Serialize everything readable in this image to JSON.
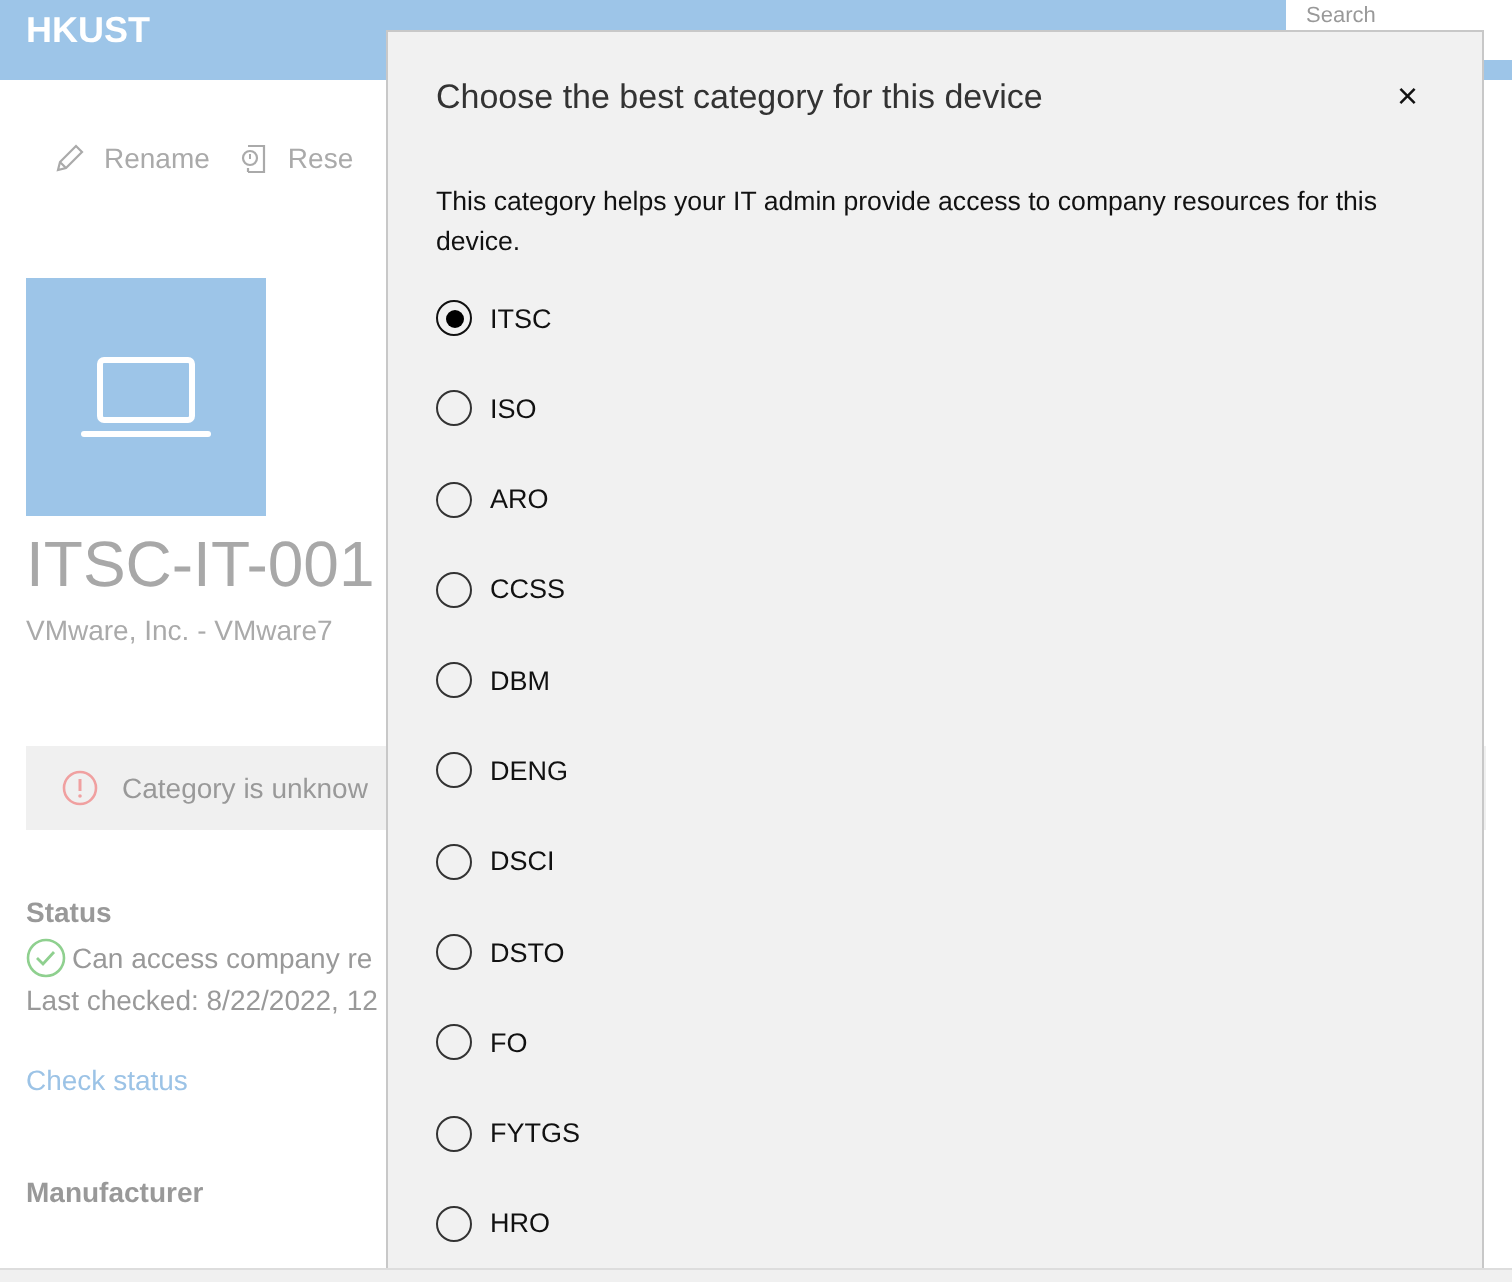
{
  "header": {
    "title": "HKUST",
    "search": {
      "placeholder": "Search"
    }
  },
  "toolbar": [
    {
      "kind": "rename",
      "label": "Rename"
    },
    {
      "kind": "reset",
      "label": "Rese"
    }
  ],
  "device": {
    "name": "ITSC-IT-001",
    "model": "VMware, Inc. - VMware7"
  },
  "alert": {
    "text": "Category is unknow"
  },
  "status": {
    "heading": "Status",
    "message": "Can access company re",
    "last_checked": "Last checked: 8/22/2022, 12",
    "link": "Check status"
  },
  "manufacturer": {
    "heading": "Manufacturer"
  },
  "dialog": {
    "title": "Choose the best category for this device",
    "close": "×",
    "description": "This category helps your IT admin provide access to company resources for this device.",
    "options": [
      {
        "label": "ITSC",
        "selected": true
      },
      {
        "label": "ISO",
        "selected": false
      },
      {
        "label": "ARO",
        "selected": false
      },
      {
        "label": "CCSS",
        "selected": false
      },
      {
        "label": "DBM",
        "selected": false
      },
      {
        "label": "DENG",
        "selected": false
      },
      {
        "label": "DSCI",
        "selected": false
      },
      {
        "label": "DSTO",
        "selected": false
      },
      {
        "label": "FO",
        "selected": false
      },
      {
        "label": "FYTGS",
        "selected": false
      },
      {
        "label": "HRO",
        "selected": false
      }
    ]
  }
}
